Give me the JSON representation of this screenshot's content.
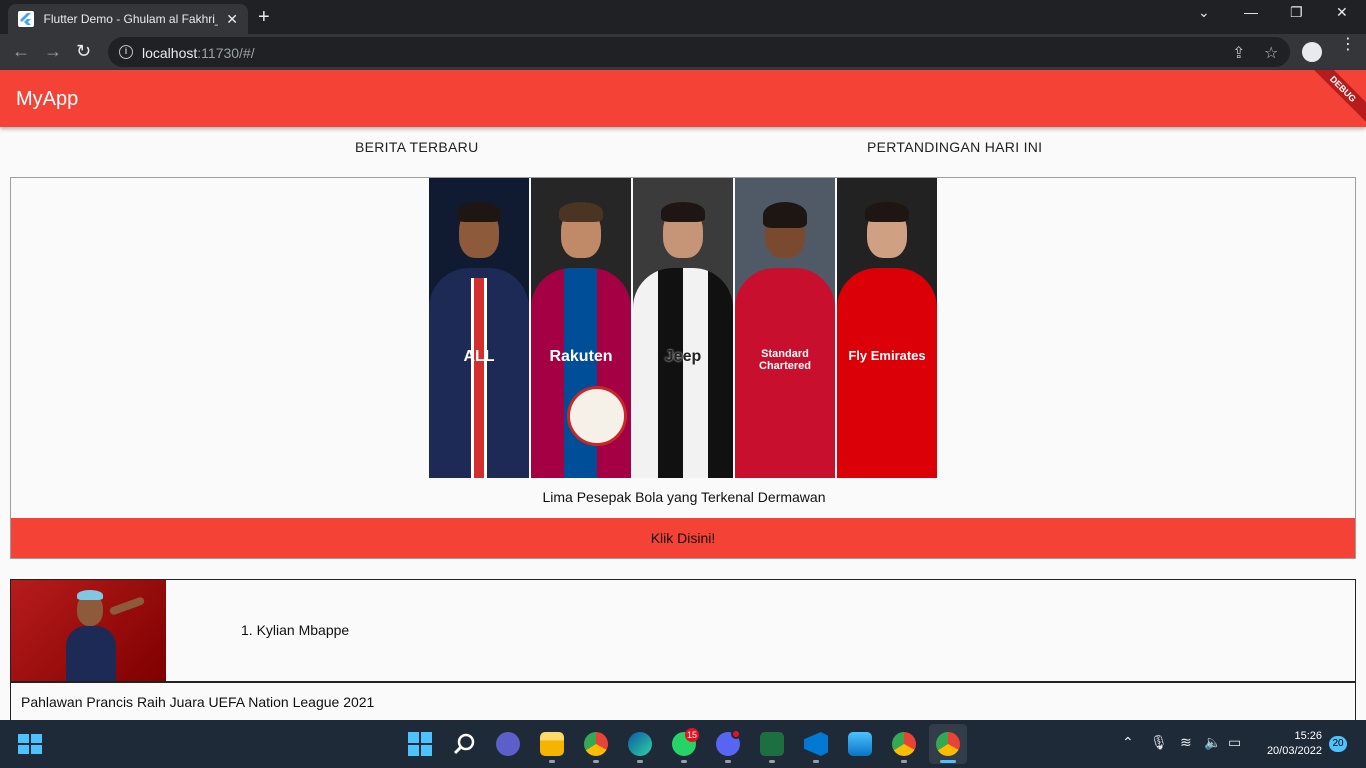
{
  "browser": {
    "tab_title": "Flutter Demo - Ghulam al Fakhri_",
    "url_host": "localhost",
    "url_rest": ":11730/#/"
  },
  "app": {
    "title": "MyApp",
    "debug_label": "DEBUG",
    "tabs": [
      "BERITA TERBARU",
      "PERTANDINGAN HARI INI"
    ],
    "featured": {
      "players": [
        {
          "sponsor": "ALL",
          "color": "#1c2a55"
        },
        {
          "sponsor": "Rakuten",
          "color": "#a50044"
        },
        {
          "sponsor": "Jeep",
          "color": "#e9e9e9"
        },
        {
          "sponsor": "Standard Chartered",
          "color": "#c8102e"
        },
        {
          "sponsor": "Fly Emirates",
          "color": "#db0007"
        }
      ],
      "caption": "Lima Pesepak Bola yang Terkenal Dermawan",
      "button_label": "Klik Disini!"
    },
    "news": [
      {
        "title": "1. Kylian Mbappe"
      },
      {
        "title": "Pahlawan Prancis Raih Juara UEFA Nation League 2021"
      }
    ]
  },
  "taskbar": {
    "whatsapp_badge": "15",
    "time": "15:26",
    "date": "20/03/2022",
    "notifications": "20"
  },
  "colors": {
    "primary": "#f44336",
    "chrome_dark": "#202124",
    "taskbar": "#1f2a38"
  }
}
